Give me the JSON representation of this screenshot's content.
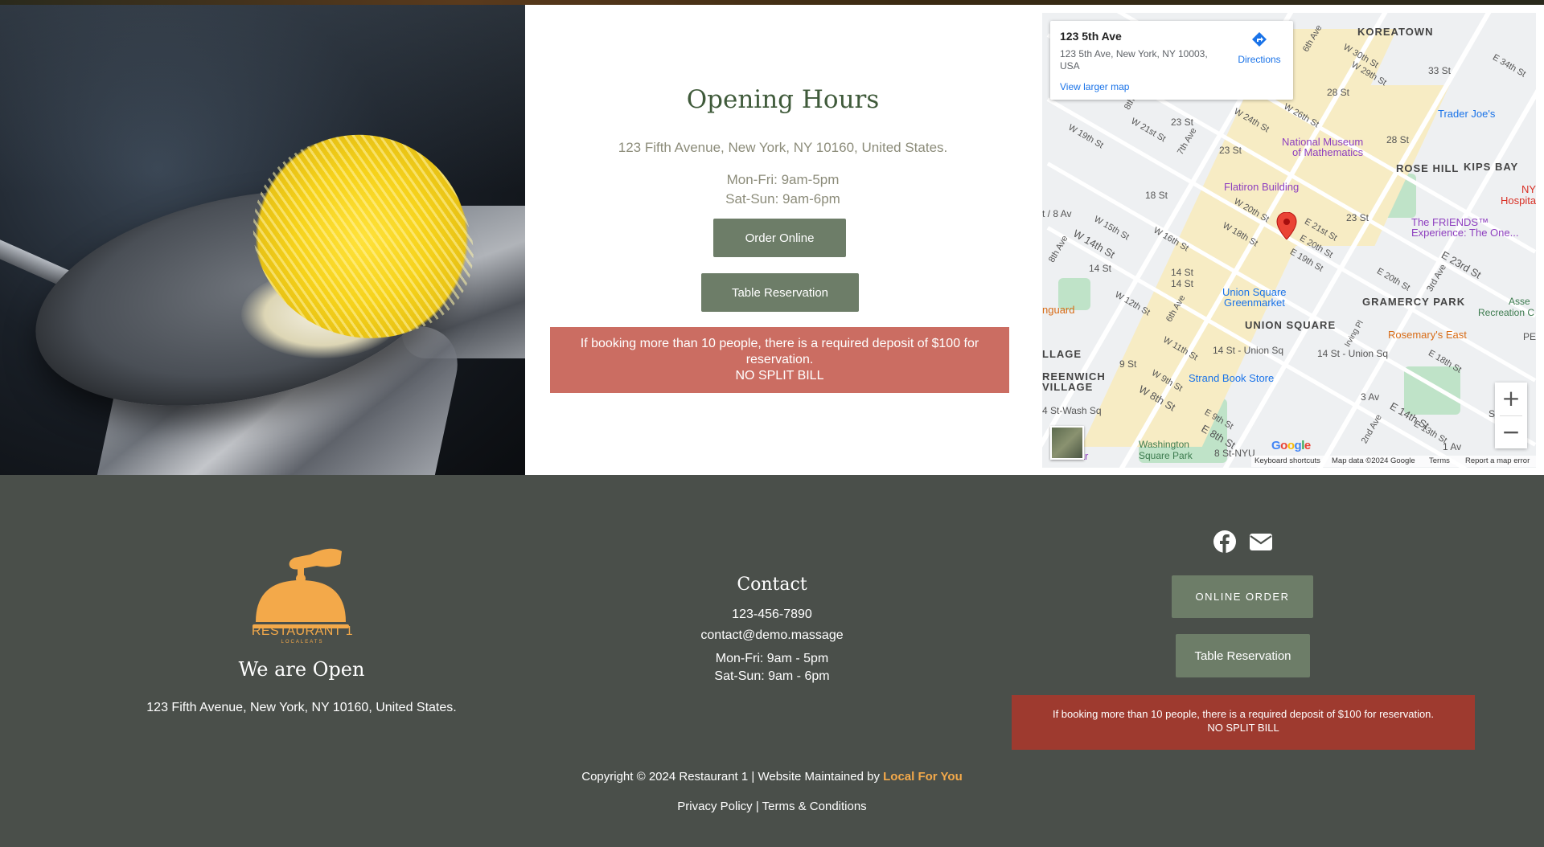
{
  "hours": {
    "title": "Opening Hours",
    "address": "123 Fifth Avenue, New York, NY 10160, United States.",
    "weekday": "Mon-Fri: 9am-5pm",
    "weekend": "Sat-Sun: 9am-6pm",
    "order_button": "Order Online",
    "table_button": "Table Reservation",
    "notice_line1": "If booking more than 10 people, there is a required deposit of $100 for reservation.",
    "notice_line2": "NO SPLIT BILL"
  },
  "map": {
    "place_title": "123 5th Ave",
    "place_address": "123 5th Ave, New York, NY 10003, USA",
    "directions": "Directions",
    "larger_map": "View larger map",
    "labels": {
      "koreatown": "KOREATOWN",
      "rose_hill": "ROSE HILL",
      "kips_bay": "KIPS BAY",
      "gramercy": "GRAMERCY PARK",
      "union_square": "UNION SQUARE",
      "greenwich": "REENWICH",
      "village": "VILLAGE",
      "llage": "LLAGE",
      "trader_joes": "Trader Joe's",
      "museum1": "National Museum",
      "museum2": "of Mathematics",
      "flatiron": "Flatiron Building",
      "friends1": "The FRIENDS™",
      "friends2": "Experience: The One...",
      "union_green1": "Union Square",
      "union_green2": "Greenmarket",
      "strand": "Strand Book Store",
      "rosemary": "Rosemary's East",
      "washington1": "Washington",
      "washington2": "Square Park",
      "st33": "33 St",
      "st28": "28 St",
      "st28b": "28 St",
      "st23": "23 St",
      "st23b": "23 St",
      "st23c": "23 St",
      "st18": "18 St",
      "st14": "14 St",
      "st14b": "14 St",
      "st14c": "14 St",
      "union_sq_st": "14 St - Union Sq",
      "union_sq_st2": "14 St - Union Sq",
      "st9": "9 St",
      "av3": "3 Av",
      "av1": "1 Av",
      "st8": "8 St-NYU",
      "wash_sq": "4 St-Wash Sq",
      "av8": "t / 8 Av",
      "guard": "nguard",
      "hospitals": "Hospitals",
      "ny": "NY",
      "asse": "Asse",
      "recreation": "Recreation C",
      "stuy": "Stuy",
      "pe": "PE",
      "llar": "llar",
      "w30": "W 30th St",
      "e34": "E 34th St",
      "w29": "W 29th St",
      "w26": "W 26th St",
      "w24": "W 24th St",
      "w21": "W 21st St",
      "w19": "W 19th St",
      "w20": "W 20th St",
      "w18": "W 18th St",
      "w15": "W 15th St",
      "w16": "W 16th St",
      "w14": "W 14th St",
      "w12": "W 12th St",
      "w11": "W 11th St",
      "w9": "W 9th St",
      "w8": "W 8th St",
      "e21": "E 21st St",
      "e20": "E 20th St",
      "e19": "E 19th St",
      "e20b": "E 20th St",
      "e23": "E 23rd St",
      "e18": "E 18th St",
      "e14": "E 14th St",
      "e13": "E 13th St",
      "e9": "E 9th St",
      "e8": "E 8th St",
      "ave8": "8th Ave",
      "ave7": "7th Ave",
      "ave6": "6th Ave",
      "ave8b": "8th Ave",
      "ave6b": "6th Ave",
      "ave3": "3rd Ave",
      "ave2": "2nd Ave",
      "irving": "Irving Pl"
    },
    "attribution": {
      "keyboard": "Keyboard shortcuts",
      "map_data": "Map data ©2024 Google",
      "terms": "Terms",
      "report": "Report a map error"
    },
    "google_logo": "Google"
  },
  "footer": {
    "logo_name": "RESTAURANT 1",
    "logo_tagline": "LOCALEATS",
    "open_title": "We are Open",
    "open_address": "123 Fifth Avenue, New York, NY 10160, United States.",
    "contact_title": "Contact",
    "phone": "123-456-7890",
    "email": "contact@demo.massage",
    "weekday": "Mon-Fri: 9am - 5pm",
    "weekend": "Sat-Sun: 9am - 6pm",
    "online_order": "ONLINE ORDER",
    "table_reservation": "Table Reservation",
    "notice_line1": "If booking more than 10 people, there is a required deposit of $100 for reservation.",
    "notice_line2": "NO SPLIT BILL",
    "copyright": "Copyright © 2024 Restaurant 1 | Website Maintained by ",
    "maintainer": "Local For You",
    "privacy": "Privacy Policy",
    "separator": " | ",
    "terms": "Terms & Conditions"
  },
  "colors": {
    "footer_bg": "#4a4f4a",
    "button_bg": "#6d7d68",
    "notice_top": "#cb6d62",
    "notice_bottom": "#9e3a2f",
    "accent": "#f3a94a",
    "heading_green": "#3f5a3a"
  },
  "icons": [
    "directions-icon",
    "map-pin-icon",
    "zoom-in-icon",
    "zoom-out-icon",
    "facebook-icon",
    "email-icon",
    "restaurant-cloche-logo"
  ]
}
